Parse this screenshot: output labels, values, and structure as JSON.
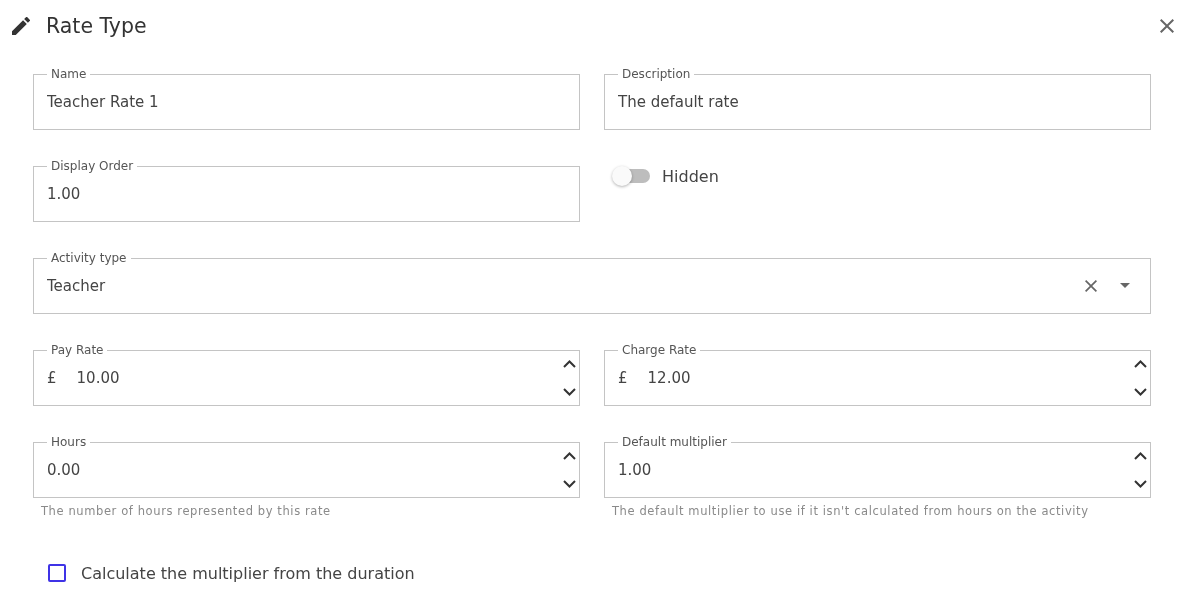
{
  "dialog": {
    "title": "Rate Type"
  },
  "rows": [
    {
      "fields": [
        {
          "kind": "text",
          "label": "Name",
          "value": "Teacher Rate 1"
        },
        {
          "kind": "text",
          "label": "Description",
          "value": "The default rate"
        }
      ]
    },
    {
      "fields": [
        {
          "kind": "text",
          "label": "Display Order",
          "value": "1.00"
        },
        {
          "kind": "switch",
          "label": "Hidden",
          "on": false
        }
      ]
    },
    {
      "fields": [
        {
          "kind": "select",
          "label": "Activity type",
          "value": "Teacher"
        }
      ]
    },
    {
      "fields": [
        {
          "kind": "number",
          "label": "Pay Rate",
          "prefix": "£",
          "value": "10.00"
        },
        {
          "kind": "number",
          "label": "Charge Rate",
          "prefix": "£",
          "value": "12.00"
        }
      ]
    },
    {
      "fields": [
        {
          "kind": "number",
          "label": "Hours",
          "value": "0.00",
          "helper": "The number of hours represented by this rate"
        },
        {
          "kind": "number",
          "label": "Default multiplier",
          "value": "1.00",
          "helper": "The default multiplier to use if it isn't calculated from hours on the activity"
        }
      ]
    },
    {
      "fields": [
        {
          "kind": "checkbox",
          "label": "Calculate the multiplier from the duration",
          "checked": false
        }
      ]
    }
  ]
}
